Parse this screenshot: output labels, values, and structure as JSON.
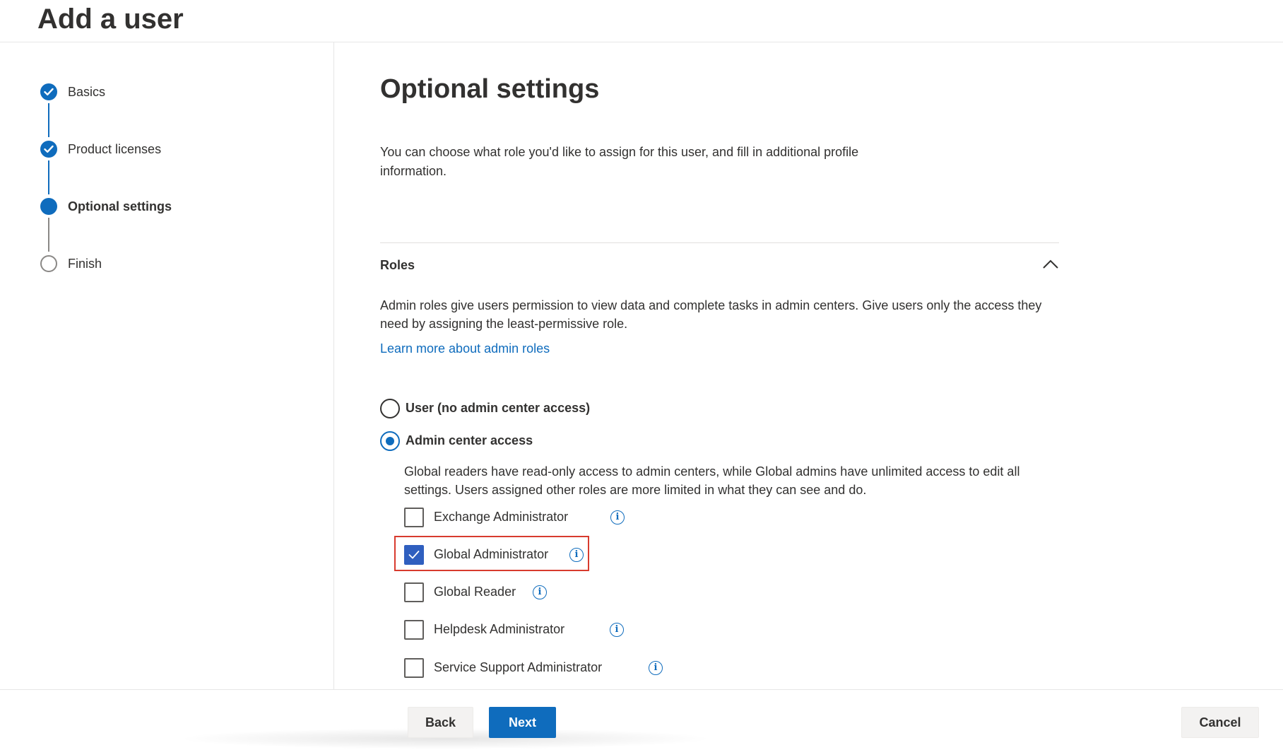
{
  "header": {
    "title": "Add a user"
  },
  "steps": [
    {
      "label": "Basics",
      "state": "done"
    },
    {
      "label": "Product licenses",
      "state": "done"
    },
    {
      "label": "Optional settings",
      "state": "current"
    },
    {
      "label": "Finish",
      "state": "pending"
    }
  ],
  "main": {
    "title": "Optional settings",
    "intro": "You can choose what role you'd like to assign for this user, and fill in additional profile information."
  },
  "roles": {
    "title": "Roles",
    "expanded": true,
    "description": "Admin roles give users permission to view data and complete tasks in admin centers. Give users only the access they need by assigning the least-permissive role.",
    "learn_more": "Learn more about admin roles",
    "options": [
      {
        "label": "User (no admin center access)",
        "selected": false
      },
      {
        "label": "Admin center access",
        "selected": true
      }
    ],
    "admin_description": "Global readers have read-only access to admin centers, while Global admins have unlimited access to edit all settings. Users assigned other roles are more limited in what they can see and do.",
    "role_checkboxes": [
      {
        "label": "Exchange Administrator",
        "checked": false
      },
      {
        "label": "Global Administrator",
        "checked": true,
        "highlighted": true
      },
      {
        "label": "Global Reader",
        "checked": false
      },
      {
        "label": "Helpdesk Administrator",
        "checked": false
      },
      {
        "label": "Service Support Administrator",
        "checked": false
      }
    ]
  },
  "footer": {
    "back_label": "Back",
    "next_label": "Next",
    "cancel_label": "Cancel"
  },
  "colors": {
    "accent": "#0f6cbd",
    "highlight": "#d83b2e",
    "checkbox_checked": "#2f5fbf"
  },
  "icons": {
    "step_done": "checkmark-circle-icon",
    "collapse": "chevron-up-icon",
    "info": "info-icon"
  }
}
